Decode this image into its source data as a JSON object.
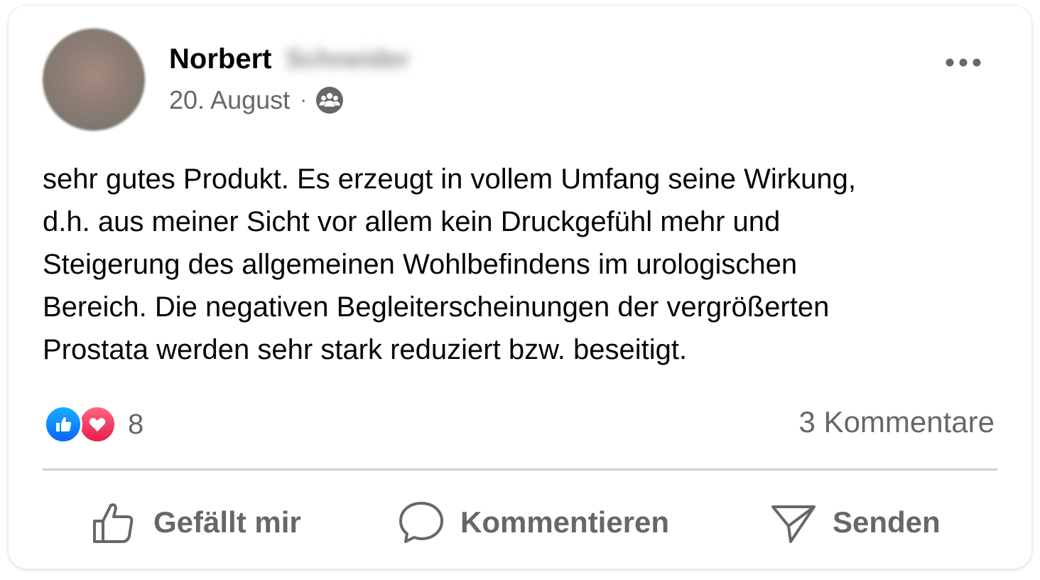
{
  "post": {
    "author_first_name": "Norbert",
    "author_last_name": "Schneider",
    "date": "20. August",
    "meta_separator": "·",
    "audience_icon": "group-icon",
    "more_icon": "more-options-icon",
    "text": "sehr gutes Produkt. Es erzeugt in vollem Umfang seine Wirkung,\nd.h. aus meiner Sicht vor allem kein Druckgefühl mehr und\nSteigerung des allgemeinen Wohlbefindens im urologischen\nBereich. Die negativen Begleiterscheinungen der vergrößerten\nProstata werden sehr stark reduziert bzw. beseitigt."
  },
  "stats": {
    "reaction_types": [
      "like",
      "love"
    ],
    "reaction_count": "8",
    "comments": "3 Kommentare"
  },
  "actions": {
    "like_label": "Gefällt mir",
    "comment_label": "Kommentieren",
    "send_label": "Senden"
  },
  "colors": {
    "text_primary": "#050505",
    "text_secondary": "#65676b",
    "like_blue": "#0866ff",
    "love_red": "#e61e4d",
    "divider": "#ced0d4"
  }
}
